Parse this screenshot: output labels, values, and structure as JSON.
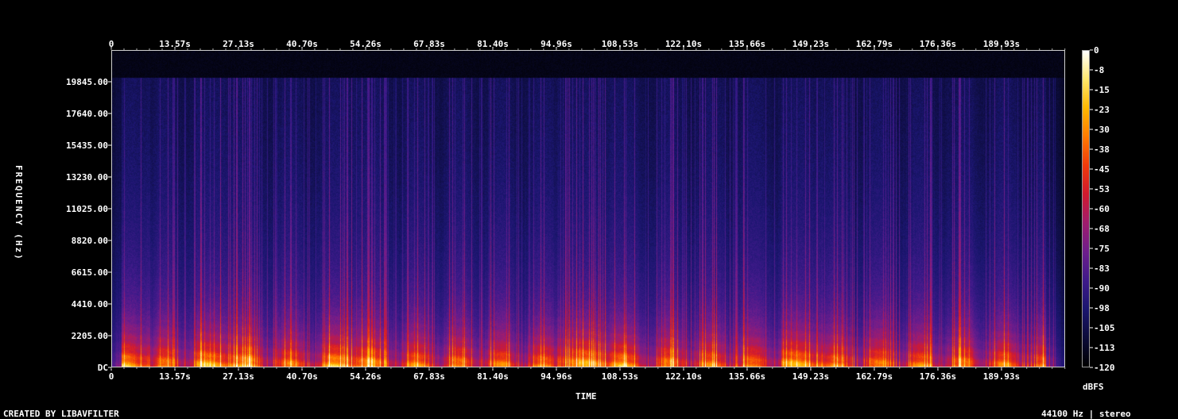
{
  "chart_data": {
    "type": "heatmap",
    "title": "",
    "xlabel": "TIME",
    "ylabel": "FREQUENCY (Hz)",
    "x_ticks": [
      "0",
      "13.57s",
      "27.13s",
      "40.70s",
      "54.26s",
      "67.83s",
      "81.40s",
      "94.96s",
      "108.53s",
      "122.10s",
      "135.66s",
      "149.23s",
      "162.79s",
      "176.36s",
      "189.93s"
    ],
    "x_tick_values": [
      0,
      13.57,
      27.13,
      40.7,
      54.26,
      67.83,
      81.4,
      94.96,
      108.53,
      122.1,
      135.66,
      149.23,
      162.79,
      176.36,
      189.93
    ],
    "xlim": [
      0,
      203.5
    ],
    "y_ticks": [
      "DC",
      "2205.00",
      "4410.00",
      "6615.00",
      "8820.00",
      "11025.00",
      "13230.00",
      "15435.00",
      "17640.00",
      "19845.00"
    ],
    "y_tick_values": [
      0,
      2205,
      4410,
      6615,
      8820,
      11025,
      13230,
      15435,
      17640,
      19845
    ],
    "ylim": [
      0,
      22050
    ],
    "colorbar": {
      "label": "dBFS",
      "ticks": [
        "0",
        "-8",
        "-15",
        "-23",
        "-30",
        "-38",
        "-45",
        "-53",
        "-60",
        "-68",
        "-75",
        "-83",
        "-90",
        "-98",
        "-105",
        "-113",
        "-120"
      ],
      "range": [
        -120,
        0
      ],
      "colormap": [
        "#000000",
        "#0c0c3a",
        "#1b1670",
        "#3f1a8a",
        "#6e1d8c",
        "#a01c6e",
        "#d11a2f",
        "#f03a0c",
        "#ff7a00",
        "#ffb800",
        "#ffe76b",
        "#ffffff"
      ]
    },
    "bright_regions_s": [
      [
        2,
        8
      ],
      [
        18,
        30
      ],
      [
        46,
        56
      ],
      [
        95,
        110
      ],
      [
        143,
        152
      ]
    ],
    "rolloff_hz": 20200
  },
  "footer": {
    "credit": "CREATED BY LIBAVFILTER",
    "info": "44100 Hz | stereo"
  }
}
